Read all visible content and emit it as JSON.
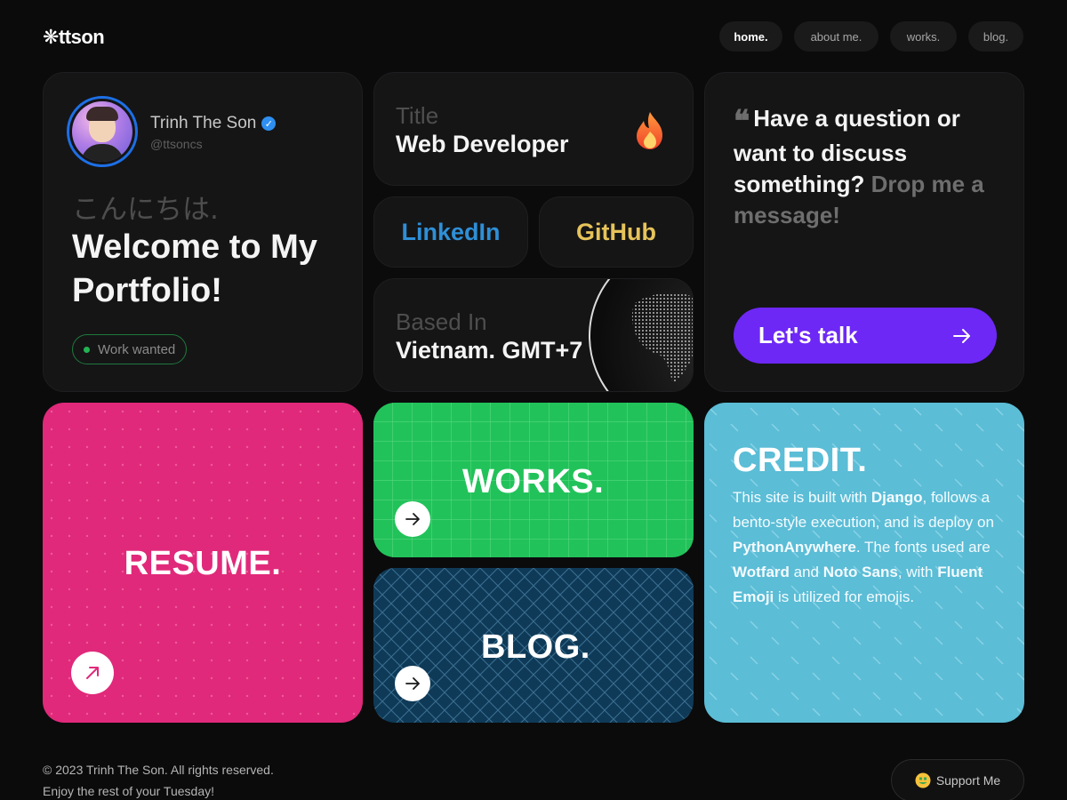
{
  "header": {
    "logo": "❋ttson",
    "nav": [
      {
        "label": "home.",
        "active": true
      },
      {
        "label": "about me.",
        "active": false
      },
      {
        "label": "works.",
        "active": false
      },
      {
        "label": "blog.",
        "active": false
      }
    ]
  },
  "profile": {
    "name": "Trinh The Son",
    "verified_icon": "verified-check-icon",
    "handle": "@ttsoncs",
    "greeting_jp": "こんにちは.",
    "welcome": "Welcome to My Portfolio!",
    "status": "Work wanted"
  },
  "title_card": {
    "label": "Title",
    "value": "Web Developer",
    "icon": "fire-icon"
  },
  "links": {
    "linkedin": "LinkedIn",
    "github": "GitHub",
    "linkedin_color": "#2f8fd6",
    "github_color": "#e6c35a"
  },
  "location": {
    "label": "Based In",
    "value": "Vietnam. GMT+7",
    "icon": "globe-icon"
  },
  "contact": {
    "question": "Have a question or want to discuss something?",
    "cta_muted": "Drop me a message!",
    "button": "Let's talk",
    "button_icon": "arrow-right-icon"
  },
  "tiles": {
    "resume": "RESUME.",
    "works": "WORKS.",
    "blog": "BLOG.",
    "resume_color": "#e0297a",
    "works_color": "#22c25a",
    "blog_color": "#0f3a57"
  },
  "credit": {
    "title": "CREDIT.",
    "t1": "This site is built with ",
    "b1": "Django",
    "t2": ", follows a bento-style execution, and is deploy on ",
    "b2": "PythonAnywhere",
    "t3": ". The fonts used are ",
    "b3": "Wotfard",
    "t4": " and ",
    "b4": "Noto Sans",
    "t5": ", with ",
    "b5": "Fluent Emoji",
    "t6": " is utilized for emojis.",
    "color": "#5bbdd6"
  },
  "footer": {
    "copyright": "© 2023 Trinh The Son. All rights reserved.",
    "greeting": "Enjoy the rest of your Tuesday!",
    "support": "Support Me",
    "support_icon": "money-mouth-face-icon"
  }
}
